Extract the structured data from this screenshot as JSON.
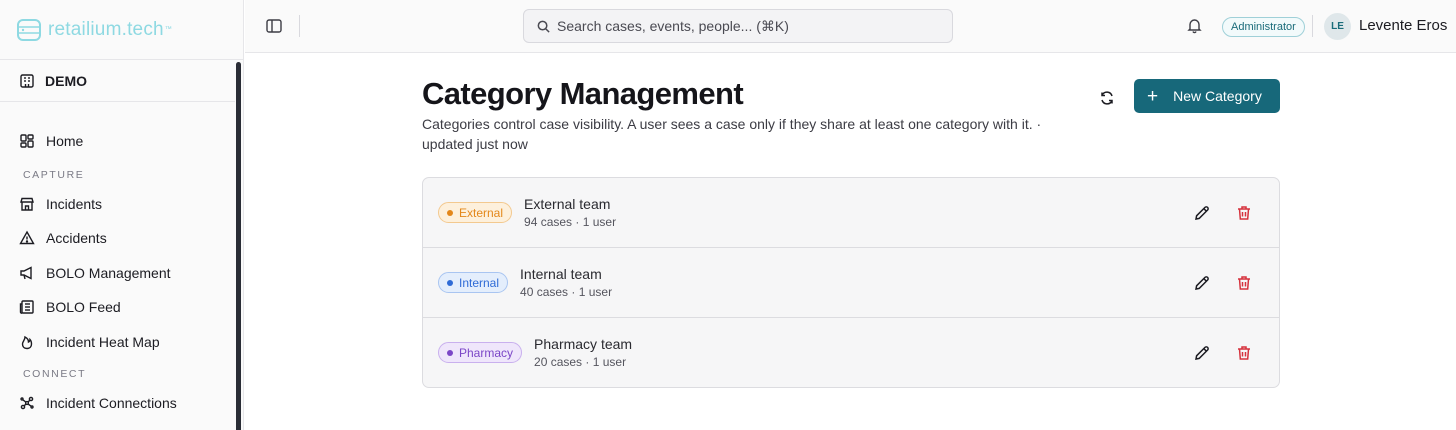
{
  "brand": {
    "name": "retailium.tech",
    "tm": "™"
  },
  "org": {
    "label": "DEMO"
  },
  "nav": {
    "home": "Home",
    "capture_section": "CAPTURE",
    "incidents": "Incidents",
    "accidents": "Accidents",
    "bolo_management": "BOLO Management",
    "bolo_feed": "BOLO Feed",
    "heat_map": "Incident Heat Map",
    "connect_section": "CONNECT",
    "connections": "Incident Connections"
  },
  "topbar": {
    "search_placeholder": "Search cases, events, people... (⌘K)",
    "role": "Administrator",
    "avatar_initials": "LE",
    "user_name": "Levente Eros"
  },
  "page": {
    "title": "Category Management",
    "description": "Categories control case visibility. A user sees a case only if they share at least one category with it. · updated just now",
    "new_button": "New Category"
  },
  "categories": [
    {
      "tag": "External",
      "name": "External team",
      "meta": "94 cases · 1 user",
      "color": "#e3871a",
      "bg": "#fdf0dc",
      "border": "#f3c98f"
    },
    {
      "tag": "Internal",
      "name": "Internal team",
      "meta": "40 cases · 1 user",
      "color": "#2f6bd6",
      "bg": "#e4eefc",
      "border": "#a9c5f1"
    },
    {
      "tag": "Pharmacy",
      "name": "Pharmacy team",
      "meta": "20 cases · 1 user",
      "color": "#7b46c7",
      "bg": "#efe6fb",
      "border": "#c9b0ee"
    }
  ],
  "colors": {
    "accent": "#17687a",
    "danger": "#d6313c",
    "brand": "#8ed9e2"
  }
}
